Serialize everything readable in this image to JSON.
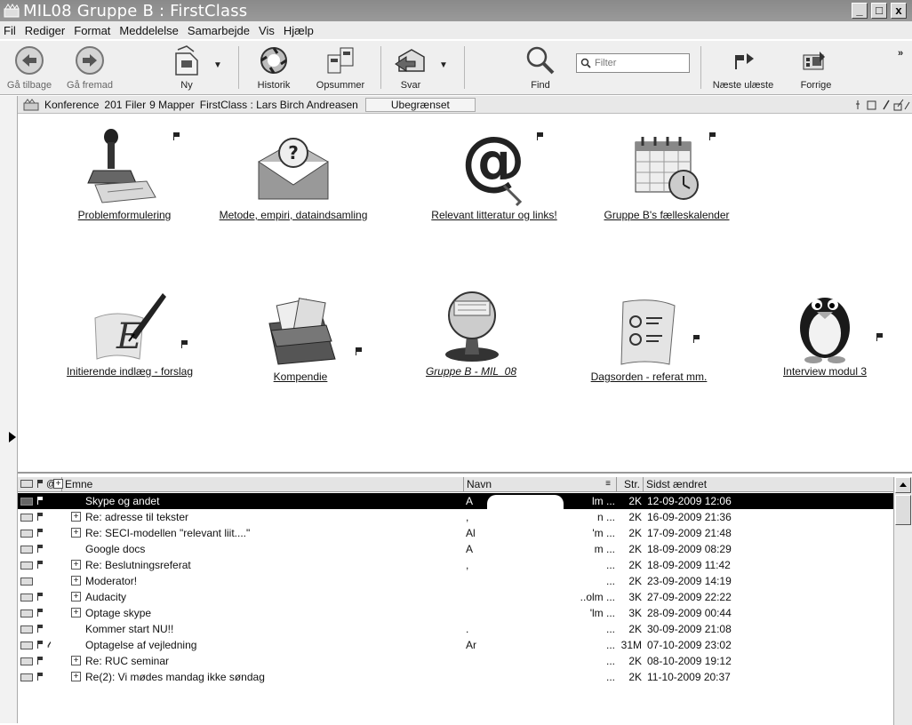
{
  "window": {
    "title": "MIL08 Gruppe B : FirstClass",
    "controls": [
      "_",
      "□",
      "x"
    ]
  },
  "menu": [
    "Fil",
    "Rediger",
    "Format",
    "Meddelelse",
    "Samarbejde",
    "Vis",
    "Hjælp"
  ],
  "toolbar": {
    "back": "Gå tilbage",
    "forward": "Gå fremad",
    "new": "Ny",
    "history": "Historik",
    "summarize": "Opsummer",
    "reply": "Svar",
    "find": "Find",
    "filter_placeholder": "Filter",
    "next_unread": "Næste ulæste",
    "previous": "Forrige",
    "overflow": "»"
  },
  "statusbar": {
    "type": "Konference",
    "files": "201 Filer",
    "folders": "9 Mapper",
    "path": "FirstClass : Lars Birch Andreasen",
    "scope": "Ubegrænset"
  },
  "folders": [
    {
      "label": "Problemformulering",
      "icon": "stamp-icon"
    },
    {
      "label": "Metode, empiri, dataindsamling",
      "icon": "question-envelope-icon"
    },
    {
      "label": "Relevant litteratur og links!",
      "icon": "at-sign-icon"
    },
    {
      "label": "Gruppe B's fælleskalender",
      "icon": "calendar-icon"
    },
    {
      "label": "Initierende indlæg - forslag",
      "icon": "quill-icon"
    },
    {
      "label": "Kompendie",
      "icon": "folder-files-icon"
    },
    {
      "label": "Gruppe B - MIL_08",
      "icon": "rolodex-icon"
    },
    {
      "label": "Dagsorden - referat mm.",
      "icon": "checklist-icon"
    },
    {
      "label": "Interview modul 3",
      "icon": "penguin-icon"
    }
  ],
  "list": {
    "columns": [
      "Emne",
      "Navn",
      "Str.",
      "Sidst ændret"
    ],
    "rows": [
      {
        "subject": "Skype og andet",
        "name": "A",
        "name_tail": "lm ...",
        "size": "2K",
        "date": "12-09-2009  12:06",
        "plus": false,
        "flag": true,
        "attach": false,
        "selected": true
      },
      {
        "subject": "Re: adresse til tekster",
        "name": ",",
        "name_tail": "n ...",
        "size": "2K",
        "date": "16-09-2009  21:36",
        "plus": true,
        "flag": true,
        "attach": false,
        "selected": false
      },
      {
        "subject": "Re: SECI-modellen \"relevant liit....\"",
        "name": "Al",
        "name_tail": "'m ...",
        "size": "2K",
        "date": "17-09-2009  21:48",
        "plus": true,
        "flag": true,
        "attach": false,
        "selected": false
      },
      {
        "subject": "Google docs",
        "name": "A",
        "name_tail": "m ...",
        "size": "2K",
        "date": "18-09-2009  08:29",
        "plus": false,
        "flag": true,
        "attach": false,
        "selected": false
      },
      {
        "subject": "Re: Beslutningsreferat",
        "name": ",",
        "name_tail": "...",
        "size": "2K",
        "date": "18-09-2009  11:42",
        "plus": true,
        "flag": true,
        "attach": false,
        "selected": false
      },
      {
        "subject": "Moderator!",
        "name": "",
        "name_tail": "...",
        "size": "2K",
        "date": "23-09-2009  14:19",
        "plus": true,
        "flag": false,
        "attach": false,
        "selected": false
      },
      {
        "subject": "Audacity",
        "name": "",
        "name_tail": "..olm ...",
        "size": "3K",
        "date": "27-09-2009  22:22",
        "plus": true,
        "flag": true,
        "attach": false,
        "selected": false
      },
      {
        "subject": "Optage skype",
        "name": "",
        "name_tail": "'lm ...",
        "size": "3K",
        "date": "28-09-2009  00:44",
        "plus": true,
        "flag": true,
        "attach": false,
        "selected": false
      },
      {
        "subject": "Kommer start NU!!",
        "name": ".",
        "name_tail": "...",
        "size": "2K",
        "date": "30-09-2009  21:08",
        "plus": false,
        "flag": true,
        "attach": false,
        "selected": false
      },
      {
        "subject": "Optagelse af vejledning",
        "name": "Ar",
        "name_tail": "...",
        "size": "31M",
        "date": "07-10-2009  23:02",
        "plus": false,
        "flag": true,
        "attach": true,
        "selected": false
      },
      {
        "subject": "Re: RUC seminar",
        "name": "",
        "name_tail": "...",
        "size": "2K",
        "date": "08-10-2009  19:12",
        "plus": true,
        "flag": true,
        "attach": false,
        "selected": false
      },
      {
        "subject": "Re(2): Vi mødes mandag ikke søndag",
        "name": "",
        "name_tail": "...",
        "size": "2K",
        "date": "11-10-2009  20:37",
        "plus": true,
        "flag": true,
        "attach": false,
        "selected": false
      }
    ]
  }
}
